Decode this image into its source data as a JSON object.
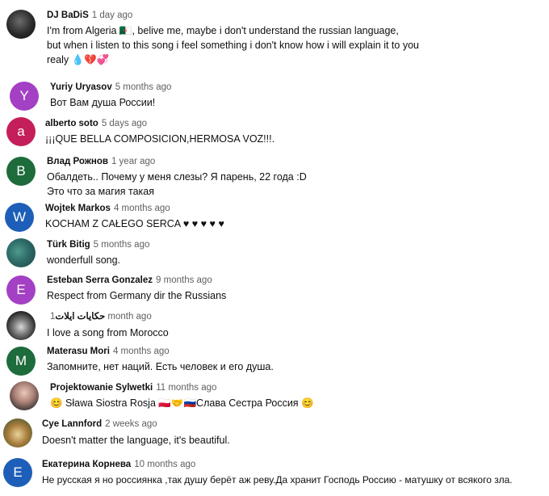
{
  "comments": [
    {
      "author": "DJ BaDiS",
      "time": "1 day ago",
      "avatar_letter": "",
      "avatar_color": "#2b2b2b",
      "lines": [
        "I'm from Algeria 🇩🇿, belive me, maybe i don't understand the russian language,",
        "but when i listen to this song i feel something i don't know how i will explain it to you",
        "realy 💧💔💞"
      ]
    },
    {
      "author": "Yuriy Uryasov",
      "time": "5 months ago",
      "avatar_letter": "Y",
      "avatar_color": "#a340c4",
      "lines": [
        "Вот Вам душа России!"
      ]
    },
    {
      "author": "alberto soto",
      "time": "5 days ago",
      "avatar_letter": "a",
      "avatar_color": "#c41f5a",
      "lines": [
        "¡¡¡QUE BELLA COMPOSICION,HERMOSA VOZ!!!."
      ]
    },
    {
      "author": "Влад Рожнов",
      "time": "1 year ago",
      "avatar_letter": "B",
      "avatar_color": "#1e6b3c",
      "lines": [
        "Обалдеть.. Почему у меня слезы? Я парень, 22 года :D",
        "Это что за магия такая"
      ]
    },
    {
      "author": "Wojtek Markos",
      "time": "4 months ago",
      "avatar_letter": "W",
      "avatar_color": "#1d5fb8",
      "lines": [
        "KOCHAM Z CAŁEGO SERCA ♥ ♥ ♥ ♥ ♥"
      ]
    },
    {
      "author": "Türk Bitig",
      "time": "5 months ago",
      "avatar_letter": "",
      "avatar_color": "#2e6c68",
      "lines": [
        "wonderfull song."
      ]
    },
    {
      "author": "Esteban Serra Gonzalez",
      "time": "9 months ago",
      "avatar_letter": "E",
      "avatar_color": "#a340c4",
      "lines": [
        "Respect from Germany dir the Russians"
      ]
    },
    {
      "author": "حكايات ايلات",
      "time": "1 month ago",
      "avatar_letter": "",
      "avatar_color": "#1c1c1c",
      "lines": [
        "I love a song from Morocco"
      ]
    },
    {
      "author": "Materasu Mori",
      "time": "4 months ago",
      "avatar_letter": "M",
      "avatar_color": "#1e6b3c",
      "lines": [
        "Запомните, нет наций. Есть человек и его душа."
      ]
    },
    {
      "author": "Projektowanie Sylwetki",
      "time": "11 months ago",
      "avatar_letter": "",
      "avatar_color": "#b0857a",
      "lines": [
        "😊 Sława Siostra Rosja 🇵🇱🤝🇷🇺Слава Сестра Россия 😊"
      ]
    },
    {
      "author": "Cye Lannford",
      "time": "2 weeks ago",
      "avatar_letter": "",
      "avatar_color": "#a97d3d",
      "lines": [
        "Doesn't matter the language, it's beautiful."
      ]
    },
    {
      "author": "Екатерина Корнева",
      "time": "10 months ago",
      "avatar_letter": "E",
      "avatar_color": "#1d5fb8",
      "lines": [
        "Не русская   я но россиянка ,так душу берёт аж реву.Да   хранит Господь Россию - матушку от всякого зла."
      ]
    }
  ]
}
